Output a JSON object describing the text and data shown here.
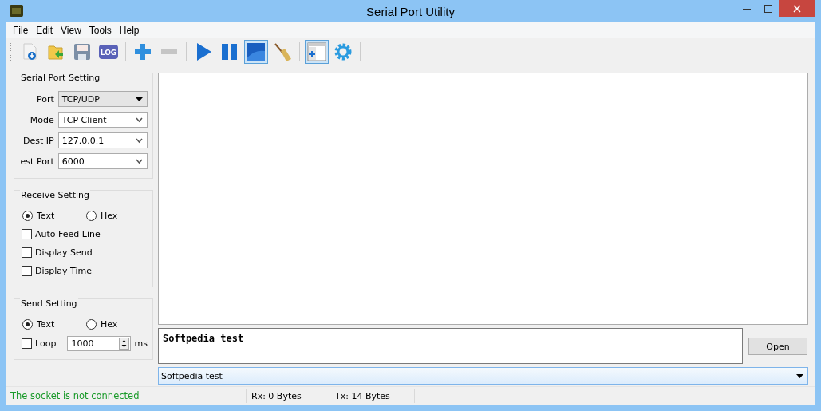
{
  "window": {
    "title": "Serial Port Utility"
  },
  "menu": [
    "File",
    "Edit",
    "View",
    "Tools",
    "Help"
  ],
  "toolbar": [
    {
      "kind": "new"
    },
    {
      "kind": "open"
    },
    {
      "kind": "save"
    },
    {
      "kind": "log",
      "label": "LOG"
    },
    {
      "kind": "sep"
    },
    {
      "kind": "add"
    },
    {
      "kind": "remove",
      "disabled": true
    },
    {
      "kind": "sep"
    },
    {
      "kind": "play"
    },
    {
      "kind": "pause"
    },
    {
      "kind": "stop",
      "pressed": true
    },
    {
      "kind": "clear"
    },
    {
      "kind": "sep"
    },
    {
      "kind": "window",
      "pressed": true
    },
    {
      "kind": "settings"
    },
    {
      "kind": "sep"
    }
  ],
  "serial_port_setting": {
    "title": "Serial Port Setting",
    "fields": [
      {
        "label": "Port",
        "value": "TCP/UDP",
        "kind": "dropdown"
      },
      {
        "label": "Mode",
        "value": "TCP Client",
        "kind": "combo"
      },
      {
        "label": "Dest IP",
        "value": "127.0.0.1",
        "kind": "combo"
      },
      {
        "label": "est Port",
        "value": "6000",
        "kind": "combo"
      }
    ]
  },
  "receive_setting": {
    "title": "Receive Setting",
    "format": [
      {
        "label": "Text",
        "selected": true
      },
      {
        "label": "Hex",
        "selected": false
      }
    ],
    "options": [
      {
        "label": "Auto Feed Line",
        "checked": false
      },
      {
        "label": "Display Send",
        "checked": false
      },
      {
        "label": "Display Time",
        "checked": false
      }
    ]
  },
  "send_setting": {
    "title": "Send Setting",
    "format": [
      {
        "label": "Text",
        "selected": true
      },
      {
        "label": "Hex",
        "selected": false
      }
    ],
    "loop": {
      "label": "Loop",
      "checked": false,
      "value": "1000",
      "unit": "ms"
    }
  },
  "send_input": {
    "value": "Softpedia test"
  },
  "open_button": "Open",
  "history_combo": {
    "value": "Softpedia test"
  },
  "status_bar": {
    "message": "The socket is not connected",
    "rx": "Rx: 0 Bytes",
    "tx": "Tx: 14 Bytes"
  }
}
